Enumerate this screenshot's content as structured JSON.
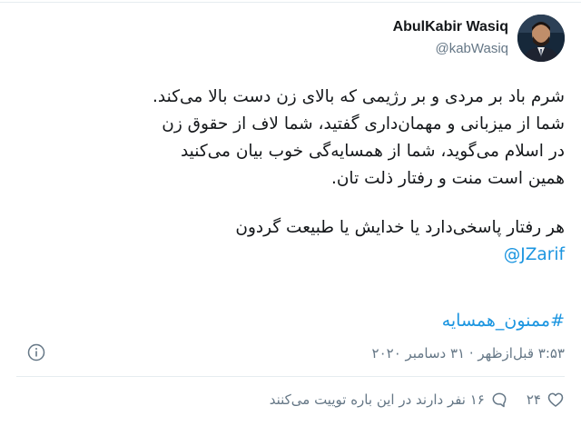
{
  "tweet": {
    "display_name": "AbulKabir Wasiq",
    "handle": "@kabWasiq",
    "lines": [
      "شرم باد بر مردی و بر رژیمی که بالای زن دست بالا می‌کند.",
      "شما از میزبانی و مهمان‌داری گفتید، شما لاف از حقوق زن",
      "در اسلام می‌گوید، شما از همسایه‌گی خوب بیان می‌کنید",
      "همین است منت و رفتار ذلت تان."
    ],
    "line_after_gap": "هر رفتار پاسخی‌دارد یا خدایش یا طبیعت گردون",
    "mention": "@JZarif",
    "hashtag": "#ممنون_همسایه",
    "timestamp": "۳:۵۳ قبل‌ازظهر · ۳۱ دسامبر ۲۰۲۰",
    "likes": "۲۴",
    "talking_text": "۱۶ نفر دارند در این باره توییت می‌کنند"
  },
  "colors": {
    "link": "#1b95e0",
    "secondary_text": "#657786",
    "divider": "#e6ecf0"
  },
  "icons": [
    "info-icon",
    "heart-icon",
    "comment-bubble-icon",
    "avatar"
  ]
}
